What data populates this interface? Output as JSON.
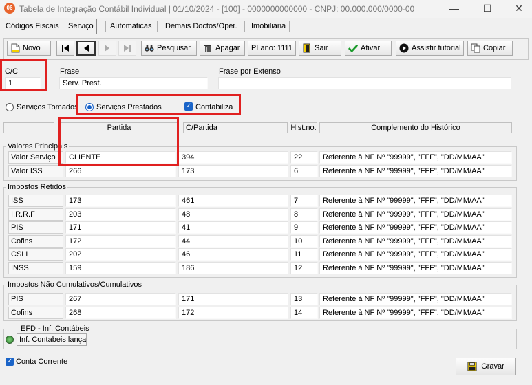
{
  "window": {
    "title": "Tabela de Integração Contábil Individual  |  01/10/2024 - [100] - 0000000000000 - CNPJ: 00.000.000/0000-00",
    "icon_text": "06"
  },
  "tabs": [
    "Códigos Fiscais",
    "Serviço",
    "Automaticas",
    "Demais Doctos/Oper.",
    "Imobiliária"
  ],
  "toolbar": {
    "novo": "Novo",
    "pesquisar": "Pesquisar",
    "apagar": "Apagar",
    "plano": "PLano: 1111",
    "sair": "Sair",
    "ativar": "Ativar",
    "tutorial": "Assistir tutorial",
    "copiar": "Copiar"
  },
  "header_fields": {
    "cc_label": "C/C",
    "cc_value": "1",
    "frase_label": "Frase",
    "frase_value": "Serv. Prest.",
    "extenso_label": "Frase por Extenso",
    "extenso_value": ""
  },
  "options": {
    "tomados": "Serviços Tomados",
    "prestados": "Serviços Prestados",
    "contabiliza": "Contabiliza"
  },
  "columns": [
    "Partida",
    "C/Partida",
    "Hist.no.",
    "Complemento do Histórico"
  ],
  "groups": {
    "principais": {
      "title": "Valores Principais",
      "rows": [
        {
          "label": "Valor Serviço",
          "partida": "CLIENTE",
          "cpartida": "394",
          "hist": "22",
          "complemento": "Referente à NF Nº \"99999\", \"FFF\", \"DD/MM/AA\""
        },
        {
          "label": "Valor ISS",
          "partida": "266",
          "cpartida": "173",
          "hist": "6",
          "complemento": "Referente à NF Nº \"99999\", \"FFF\", \"DD/MM/AA\""
        }
      ]
    },
    "retidos": {
      "title": "Impostos Retidos",
      "rows": [
        {
          "label": "ISS",
          "partida": "173",
          "cpartida": "461",
          "hist": "7",
          "complemento": "Referente à NF Nº \"99999\", \"FFF\", \"DD/MM/AA\""
        },
        {
          "label": "I.R.R.F",
          "partida": "203",
          "cpartida": "48",
          "hist": "8",
          "complemento": "Referente à NF Nº \"99999\", \"FFF\", \"DD/MM/AA\""
        },
        {
          "label": "PIS",
          "partida": "171",
          "cpartida": "41",
          "hist": "9",
          "complemento": "Referente à NF Nº \"99999\", \"FFF\", \"DD/MM/AA\""
        },
        {
          "label": "Cofins",
          "partida": "172",
          "cpartida": "44",
          "hist": "10",
          "complemento": "Referente à NF Nº \"99999\", \"FFF\", \"DD/MM/AA\""
        },
        {
          "label": "CSLL",
          "partida": "202",
          "cpartida": "46",
          "hist": "11",
          "complemento": "Referente à NF Nº \"99999\", \"FFF\", \"DD/MM/AA\""
        },
        {
          "label": "INSS",
          "partida": "159",
          "cpartida": "186",
          "hist": "12",
          "complemento": "Referente à NF Nº \"99999\", \"FFF\", \"DD/MM/AA\""
        }
      ]
    },
    "cumulativos": {
      "title": "Impostos Não Cumulativos/Cumulativos",
      "rows": [
        {
          "label": "PIS",
          "partida": "267",
          "cpartida": "171",
          "hist": "13",
          "complemento": "Referente à NF Nº \"99999\", \"FFF\", \"DD/MM/AA\""
        },
        {
          "label": "Cofins",
          "partida": "268",
          "cpartida": "172",
          "hist": "14",
          "complemento": "Referente à NF Nº \"99999\", \"FFF\", \"DD/MM/AA\""
        }
      ]
    }
  },
  "efd": {
    "title": "EFD - Inf. Contábeis",
    "button": "Inf. Contabeis lançamentos"
  },
  "footer": {
    "conta_corrente": "Conta Corrente",
    "gravar": "Gravar"
  },
  "colors": {
    "highlight": "#e02020",
    "accent": "#1560c8"
  }
}
